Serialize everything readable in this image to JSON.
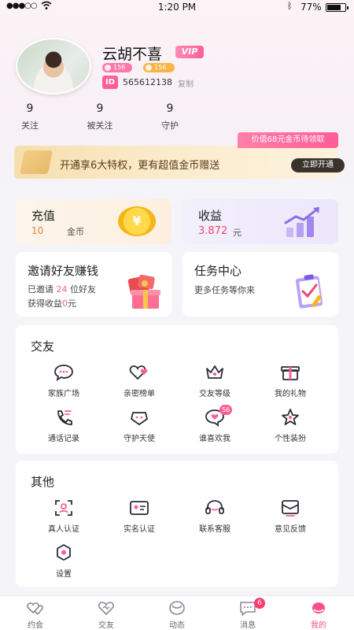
{
  "status_bar": {
    "carrier": "●●●○○",
    "time": "1:20 PM",
    "battery_percent": "77%",
    "battery_level": 0.77
  },
  "profile": {
    "username": "云胡不喜",
    "vip_label": "VIP",
    "wealth_level": "156",
    "charm_level": "156",
    "id_tag": "ID",
    "id_number": "565612138",
    "copy_label": "复制"
  },
  "stats": [
    {
      "count": "9",
      "label": "关注"
    },
    {
      "count": "9",
      "label": "被关注"
    },
    {
      "count": "9",
      "label": "守护"
    }
  ],
  "vip_banner": {
    "promo_tag": "价值68元金币待领取",
    "text": "开通享6大特权，更有超值金币赠送",
    "button": "立即开通"
  },
  "recharge": {
    "title": "充值",
    "amount": "10",
    "unit": "金币",
    "coin_symbol": "¥"
  },
  "income": {
    "title": "收益",
    "amount": "3.872",
    "unit": "元"
  },
  "invite": {
    "title": "邀请好友赚钱",
    "line1_prefix": "已邀请",
    "invited_count": "24",
    "line1_suffix": "位好友",
    "line2_prefix": "获得收益",
    "earned": "0",
    "line2_suffix": "元"
  },
  "task": {
    "title": "任务中心",
    "subtitle": "更多任务等你来"
  },
  "friends_section": {
    "title": "交友",
    "items": [
      {
        "label": "家族广场",
        "icon": "chat-bubble-icon"
      },
      {
        "label": "亲密榜单",
        "icon": "hearts-icon"
      },
      {
        "label": "交友等级",
        "icon": "crown-icon"
      },
      {
        "label": "我的礼物",
        "icon": "gift-icon"
      },
      {
        "label": "通话记录",
        "icon": "phone-icon"
      },
      {
        "label": "守护天使",
        "icon": "angel-icon"
      },
      {
        "label": "谁喜欢我",
        "icon": "heart-bubble-icon",
        "badge": "56"
      },
      {
        "label": "个性装扮",
        "icon": "star-icon"
      }
    ]
  },
  "other_section": {
    "title": "其他",
    "items": [
      {
        "label": "真人认证",
        "icon": "face-verify-icon"
      },
      {
        "label": "实名认证",
        "icon": "id-card-icon"
      },
      {
        "label": "联系客服",
        "icon": "headset-icon"
      },
      {
        "label": "意见反馈",
        "icon": "feedback-icon"
      },
      {
        "label": "设置",
        "icon": "settings-icon"
      }
    ]
  },
  "tabbar": [
    {
      "label": "约会",
      "icon": "date-hearts-icon"
    },
    {
      "label": "交友",
      "icon": "heart-outline-icon"
    },
    {
      "label": "动态",
      "icon": "moment-icon"
    },
    {
      "label": "消息",
      "icon": "message-icon",
      "badge": "6"
    },
    {
      "label": "我的",
      "icon": "profile-icon",
      "active": true
    }
  ],
  "colors": {
    "accent": "#ff5e95",
    "recharge_amount": "#e8823c",
    "income_amount": "#e84a6a",
    "gold": "#f5b619"
  }
}
